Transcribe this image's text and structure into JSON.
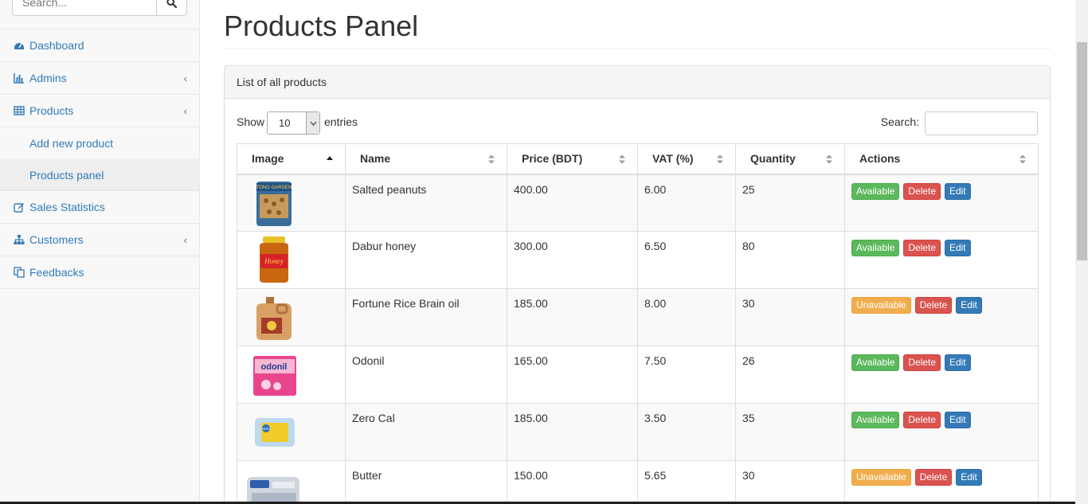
{
  "sidebar": {
    "search_placeholder": "Search...",
    "items": [
      {
        "label": "Dashboard",
        "icon": "dashboard-icon"
      },
      {
        "label": "Admins",
        "icon": "bar-chart-icon"
      },
      {
        "label": "Products",
        "icon": "table-icon"
      },
      {
        "label": "Sales Statistics",
        "icon": "edit-icon"
      },
      {
        "label": "Customers",
        "icon": "sitemap-icon"
      },
      {
        "label": "Feedbacks",
        "icon": "copy-icon"
      }
    ],
    "sub_items": [
      {
        "label": "Add new product"
      },
      {
        "label": "Products panel"
      }
    ]
  },
  "page": {
    "title": "Products Panel"
  },
  "panel": {
    "heading": "List of all products",
    "show_label": "Show",
    "entries_value": "10",
    "entries_label": "entries",
    "search_label": "Search:"
  },
  "table": {
    "headers": [
      "Image",
      "Name",
      "Price (BDT)",
      "VAT (%)",
      "Quantity",
      "Actions"
    ],
    "rows": [
      {
        "name": "Salted peanuts",
        "price": "400.00",
        "vat": "6.00",
        "quantity": "25",
        "status": "Available"
      },
      {
        "name": "Dabur honey",
        "price": "300.00",
        "vat": "6.50",
        "quantity": "80",
        "status": "Available"
      },
      {
        "name": "Fortune Rice Brain oil",
        "price": "185.00",
        "vat": "8.00",
        "quantity": "30",
        "status": "Unavailable"
      },
      {
        "name": "Odonil",
        "price": "165.00",
        "vat": "7.50",
        "quantity": "26",
        "status": "Available"
      },
      {
        "name": "Zero Cal",
        "price": "185.00",
        "vat": "3.50",
        "quantity": "35",
        "status": "Available"
      },
      {
        "name": "Butter",
        "price": "150.00",
        "vat": "5.65",
        "quantity": "30",
        "status": "Unavailable"
      }
    ],
    "delete_label": "Delete",
    "edit_label": "Edit"
  },
  "colors": {
    "link": "#337ab7",
    "available": "#5cb85c",
    "unavailable": "#f0ad4e",
    "delete": "#d9534f",
    "edit": "#337ab7"
  }
}
